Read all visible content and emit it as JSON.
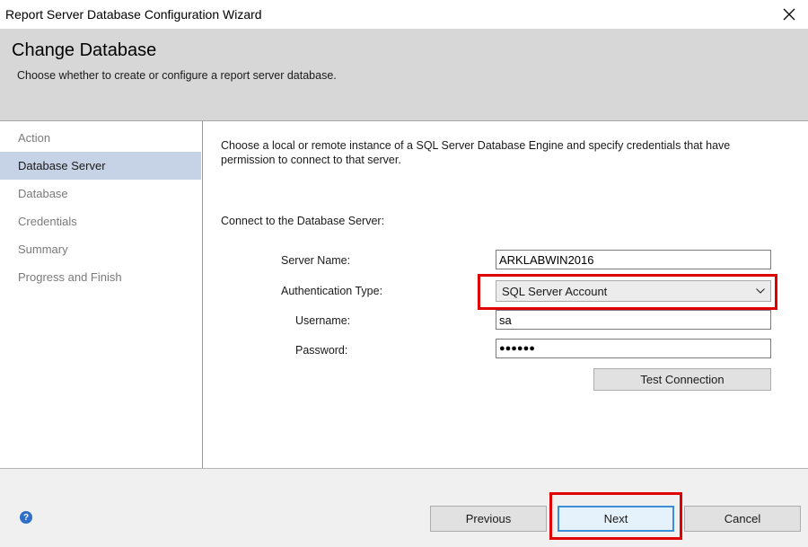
{
  "window": {
    "title": "Report Server Database Configuration Wizard"
  },
  "header": {
    "title": "Change Database",
    "subtitle": "Choose whether to create or configure a report server database."
  },
  "sidebar": {
    "items": [
      {
        "label": "Action"
      },
      {
        "label": "Database Server"
      },
      {
        "label": "Database"
      },
      {
        "label": "Credentials"
      },
      {
        "label": "Summary"
      },
      {
        "label": "Progress and Finish"
      }
    ],
    "active_index": 1
  },
  "main": {
    "description": "Choose a local or remote instance of a SQL Server Database Engine and specify credentials that have permission to connect to that server.",
    "section_label": "Connect to the Database Server:",
    "server_name": {
      "label": "Server Name:",
      "value": "ARKLABWIN2016"
    },
    "auth_type": {
      "label": "Authentication Type:",
      "value": "SQL Server Account"
    },
    "username": {
      "label": "Username:",
      "value": "sa"
    },
    "password": {
      "label": "Password:",
      "value": "●●●●●●"
    },
    "test_button": "Test Connection"
  },
  "footer": {
    "previous": "Previous",
    "next": "Next",
    "cancel": "Cancel"
  },
  "icons": {
    "help": "help-icon",
    "close": "close-icon",
    "dropdown": "chevron-down-icon"
  },
  "colors": {
    "highlight": "#e00000",
    "active_nav": "#c6d3e6",
    "default_button_border": "#3c8fd6"
  }
}
